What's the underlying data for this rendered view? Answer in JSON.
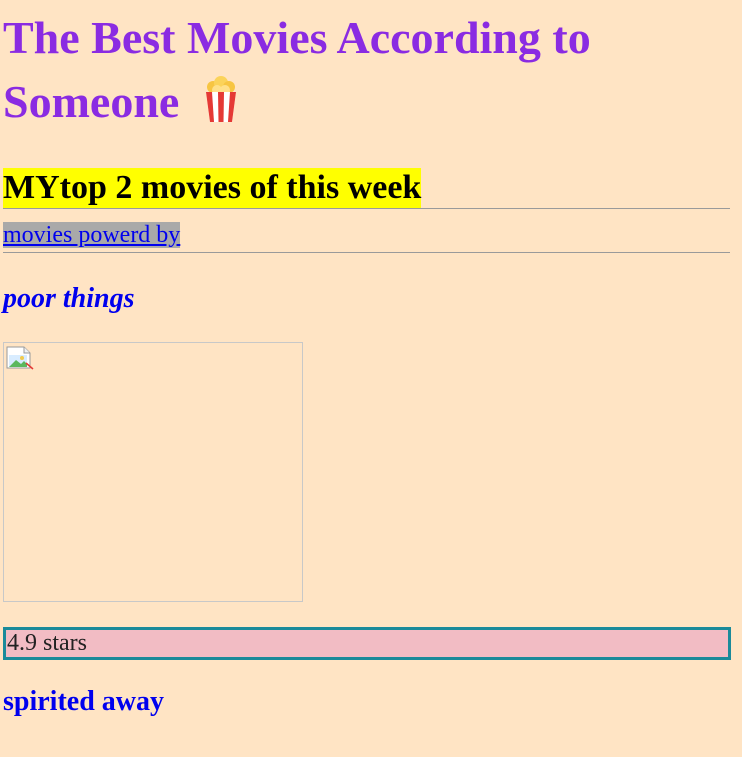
{
  "header": {
    "title": "The Best Movies According to Someone",
    "icon": "popcorn-icon"
  },
  "subtitle": "MYtop 2 movies of this week",
  "powered_link": "movies powerd by",
  "movies": [
    {
      "title": "poor things",
      "poster_icon": "broken-image-icon",
      "rating": "4.9 stars"
    },
    {
      "title": "spirited away"
    }
  ],
  "colors": {
    "background": "#ffe4c4",
    "title": "#8a2be2",
    "subtitle_highlight": "#ffff00",
    "link": "#0000ee",
    "link_highlight": "#a9a9a9",
    "rating_bg": "#f2bcc4",
    "rating_border": "#1a8a9a"
  }
}
